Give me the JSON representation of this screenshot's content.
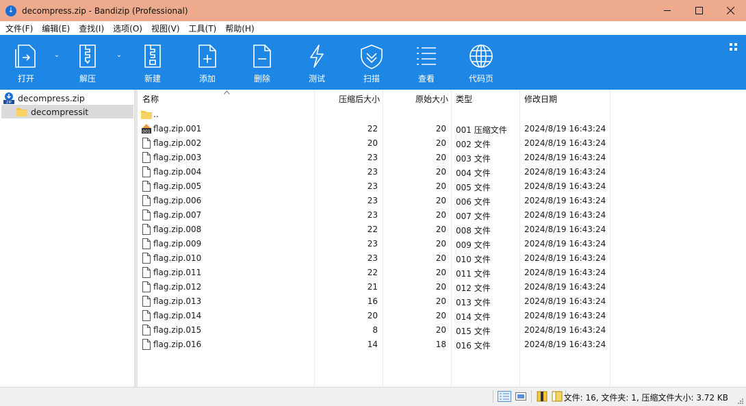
{
  "window": {
    "title": "decompress.zip - Bandizip (Professional)",
    "minimize": "—",
    "maximize": "☐",
    "close": "✕"
  },
  "menu": [
    "文件(F)",
    "编辑(E)",
    "查找(I)",
    "选项(O)",
    "视图(V)",
    "工具(T)",
    "帮助(H)"
  ],
  "toolbar": {
    "open": "打开",
    "extract": "解压",
    "new": "新建",
    "add": "添加",
    "delete": "删除",
    "test": "测试",
    "scan": "扫描",
    "view": "查看",
    "codepage": "代码页"
  },
  "tree": {
    "root": "decompress.zip",
    "child": "decompressit"
  },
  "columns": {
    "name": "名称",
    "compressed": "压缩后大小",
    "original": "原始大小",
    "type": "类型",
    "modified": "修改日期"
  },
  "parent_row": "..",
  "files": [
    {
      "name": "flag.zip.001",
      "compressed": "22",
      "original": "20",
      "type": "001 压缩文件",
      "modified": "2024/8/19 16:43:24"
    },
    {
      "name": "flag.zip.002",
      "compressed": "20",
      "original": "20",
      "type": "002 文件",
      "modified": "2024/8/19 16:43:24"
    },
    {
      "name": "flag.zip.003",
      "compressed": "23",
      "original": "20",
      "type": "003 文件",
      "modified": "2024/8/19 16:43:24"
    },
    {
      "name": "flag.zip.004",
      "compressed": "23",
      "original": "20",
      "type": "004 文件",
      "modified": "2024/8/19 16:43:24"
    },
    {
      "name": "flag.zip.005",
      "compressed": "23",
      "original": "20",
      "type": "005 文件",
      "modified": "2024/8/19 16:43:24"
    },
    {
      "name": "flag.zip.006",
      "compressed": "23",
      "original": "20",
      "type": "006 文件",
      "modified": "2024/8/19 16:43:24"
    },
    {
      "name": "flag.zip.007",
      "compressed": "23",
      "original": "20",
      "type": "007 文件",
      "modified": "2024/8/19 16:43:24"
    },
    {
      "name": "flag.zip.008",
      "compressed": "22",
      "original": "20",
      "type": "008 文件",
      "modified": "2024/8/19 16:43:24"
    },
    {
      "name": "flag.zip.009",
      "compressed": "23",
      "original": "20",
      "type": "009 文件",
      "modified": "2024/8/19 16:43:24"
    },
    {
      "name": "flag.zip.010",
      "compressed": "23",
      "original": "20",
      "type": "010 文件",
      "modified": "2024/8/19 16:43:24"
    },
    {
      "name": "flag.zip.011",
      "compressed": "22",
      "original": "20",
      "type": "011 文件",
      "modified": "2024/8/19 16:43:24"
    },
    {
      "name": "flag.zip.012",
      "compressed": "21",
      "original": "20",
      "type": "012 文件",
      "modified": "2024/8/19 16:43:24"
    },
    {
      "name": "flag.zip.013",
      "compressed": "16",
      "original": "20",
      "type": "013 文件",
      "modified": "2024/8/19 16:43:24"
    },
    {
      "name": "flag.zip.014",
      "compressed": "20",
      "original": "20",
      "type": "014 文件",
      "modified": "2024/8/19 16:43:24"
    },
    {
      "name": "flag.zip.015",
      "compressed": "8",
      "original": "20",
      "type": "015 文件",
      "modified": "2024/8/19 16:43:24"
    },
    {
      "name": "flag.zip.016",
      "compressed": "14",
      "original": "18",
      "type": "016 文件",
      "modified": "2024/8/19 16:43:24"
    }
  ],
  "status": {
    "text": "文件: 16, 文件夹: 1, 压缩文件大小: 3.72 KB"
  },
  "colors": {
    "titlebar": "#eeaa8c",
    "toolbar": "#1e86e4",
    "accent": "#1b6ed4",
    "folder": "#f4c542"
  }
}
